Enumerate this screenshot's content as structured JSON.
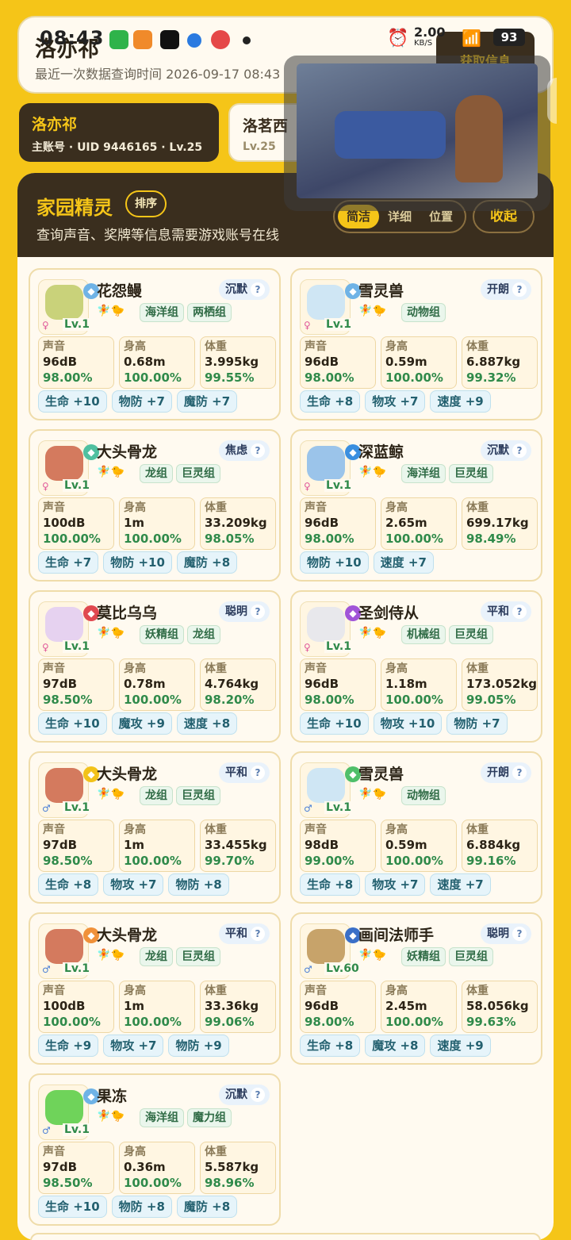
{
  "header": {
    "title": "洛亦祁",
    "subtitle": "最近一次数据查询时间 2026-09-17 08:43",
    "fetch_label": "获取信息"
  },
  "status_bar": {
    "time": "08:43",
    "net_speed": "2.00",
    "net_unit": "KB/S",
    "battery": "93"
  },
  "accounts": [
    {
      "name": "洛亦祁",
      "sub": "主账号 · UID 9446165 · Lv.25",
      "active": true
    },
    {
      "name": "洛茗西",
      "sub": "Lv.25",
      "active": false
    }
  ],
  "panel": {
    "title": "家园精灵",
    "sort_label": "排序",
    "subtitle": "查询声音、奖牌等信息需要游戏账号在线",
    "view_modes": [
      "简洁",
      "详细",
      "位置"
    ],
    "active_mode": "简洁",
    "collapse_label": "收起"
  },
  "stat_labels": {
    "sound": "声音",
    "height": "身高",
    "weight": "体重"
  },
  "sprites": [
    {
      "name": "花怨鳗",
      "mood": "沉默",
      "lv": "Lv.1",
      "gender": "♀",
      "element_color": "#6fb3e6",
      "element_icon": "snowflake-icon",
      "groups": [
        "海洋组",
        "两栖组"
      ],
      "sound": "96dB",
      "sound_pct": "98.00%",
      "height": "0.68m",
      "height_pct": "100.00%",
      "weight": "3.995kg",
      "weight_pct": "99.55%",
      "attrs": [
        "生命 +10",
        "物防 +7",
        "魔防 +7"
      ]
    },
    {
      "name": "雪灵兽",
      "mood": "开朗",
      "lv": "Lv.1",
      "gender": "♀",
      "element_color": "#6fb3e6",
      "element_icon": "snowflake-icon",
      "groups": [
        "动物组"
      ],
      "sound": "96dB",
      "sound_pct": "98.00%",
      "height": "0.59m",
      "height_pct": "100.00%",
      "weight": "6.887kg",
      "weight_pct": "99.32%",
      "attrs": [
        "生命 +8",
        "物攻 +7",
        "速度 +9"
      ]
    },
    {
      "name": "大头骨龙",
      "mood": "焦虑",
      "lv": "Lv.1",
      "gender": "♀",
      "element_color": "#4fc0a0",
      "element_icon": "gear-icon",
      "groups": [
        "龙组",
        "巨灵组"
      ],
      "sound": "100dB",
      "sound_pct": "100.00%",
      "height": "1m",
      "height_pct": "100.00%",
      "weight": "33.209kg",
      "weight_pct": "98.05%",
      "attrs": [
        "生命 +7",
        "物防 +10",
        "魔防 +8"
      ]
    },
    {
      "name": "深蓝鲸",
      "mood": "沉默",
      "lv": "Lv.1",
      "gender": "♀",
      "element_color": "#3a8fe0",
      "element_icon": "water-drop-icon",
      "groups": [
        "海洋组",
        "巨灵组"
      ],
      "sound": "96dB",
      "sound_pct": "98.00%",
      "height": "2.65m",
      "height_pct": "100.00%",
      "weight": "699.17kg",
      "weight_pct": "98.49%",
      "attrs": [
        "物防 +10",
        "速度 +7"
      ]
    },
    {
      "name": "莫比乌乌",
      "mood": "聪明",
      "lv": "Lv.1",
      "gender": "♀",
      "element_color": "#e0484f",
      "element_icon": "demon-icon",
      "groups": [
        "妖精组",
        "龙组"
      ],
      "sound": "97dB",
      "sound_pct": "98.50%",
      "height": "0.78m",
      "height_pct": "100.00%",
      "weight": "4.764kg",
      "weight_pct": "98.20%",
      "attrs": [
        "生命 +10",
        "魔攻 +9",
        "速度 +8"
      ]
    },
    {
      "name": "圣剑侍从",
      "mood": "平和",
      "lv": "Lv.1",
      "gender": "♀",
      "element_color": "#a054d8",
      "element_icon": "ghost-icon",
      "groups": [
        "机械组",
        "巨灵组"
      ],
      "sound": "96dB",
      "sound_pct": "98.00%",
      "height": "1.18m",
      "height_pct": "100.00%",
      "weight": "173.052kg",
      "weight_pct": "99.05%",
      "attrs": [
        "生命 +10",
        "物攻 +10",
        "物防 +7"
      ]
    },
    {
      "name": "大头骨龙",
      "mood": "平和",
      "lv": "Lv.1",
      "gender": "♂",
      "element_color": "#f2c21a",
      "element_icon": "lightning-icon",
      "groups": [
        "龙组",
        "巨灵组"
      ],
      "sound": "97dB",
      "sound_pct": "98.50%",
      "height": "1m",
      "height_pct": "100.00%",
      "weight": "33.455kg",
      "weight_pct": "99.70%",
      "attrs": [
        "生命 +8",
        "物攻 +7",
        "物防 +8"
      ]
    },
    {
      "name": "雪灵兽",
      "mood": "开朗",
      "lv": "Lv.1",
      "gender": "♂",
      "element_color": "#4fbf6a",
      "element_icon": "leaf-icon",
      "groups": [
        "动物组"
      ],
      "sound": "98dB",
      "sound_pct": "99.00%",
      "height": "0.59m",
      "height_pct": "100.00%",
      "weight": "6.884kg",
      "weight_pct": "99.16%",
      "attrs": [
        "生命 +8",
        "物攻 +7",
        "速度 +7"
      ]
    },
    {
      "name": "大头骨龙",
      "mood": "平和",
      "lv": "Lv.1",
      "gender": "♂",
      "element_color": "#f0913a",
      "element_icon": "fighter-icon",
      "groups": [
        "龙组",
        "巨灵组"
      ],
      "sound": "100dB",
      "sound_pct": "100.00%",
      "height": "1m",
      "height_pct": "100.00%",
      "weight": "33.36kg",
      "weight_pct": "99.06%",
      "attrs": [
        "生命 +9",
        "物攻 +7",
        "物防 +9"
      ]
    },
    {
      "name": "画间法师手",
      "mood": "聪明",
      "lv": "Lv.60",
      "gender": "♂",
      "element_color": "#3a6fc8",
      "element_icon": "star-icon",
      "groups": [
        "妖精组",
        "巨灵组"
      ],
      "sound": "96dB",
      "sound_pct": "98.00%",
      "height": "2.45m",
      "height_pct": "100.00%",
      "weight": "58.056kg",
      "weight_pct": "99.63%",
      "attrs": [
        "生命 +8",
        "魔攻 +8",
        "速度 +9"
      ]
    },
    {
      "name": "果冻",
      "mood": "沉默",
      "lv": "Lv.1",
      "gender": "♂",
      "element_color": "#6fb3e6",
      "element_icon": "snowflake-icon",
      "groups": [
        "海洋组",
        "魔力组"
      ],
      "sound": "97dB",
      "sound_pct": "98.50%",
      "height": "0.36m",
      "height_pct": "100.00%",
      "weight": "5.587kg",
      "weight_pct": "98.96%",
      "attrs": [
        "生命 +10",
        "物防 +8",
        "魔防 +8"
      ]
    }
  ]
}
